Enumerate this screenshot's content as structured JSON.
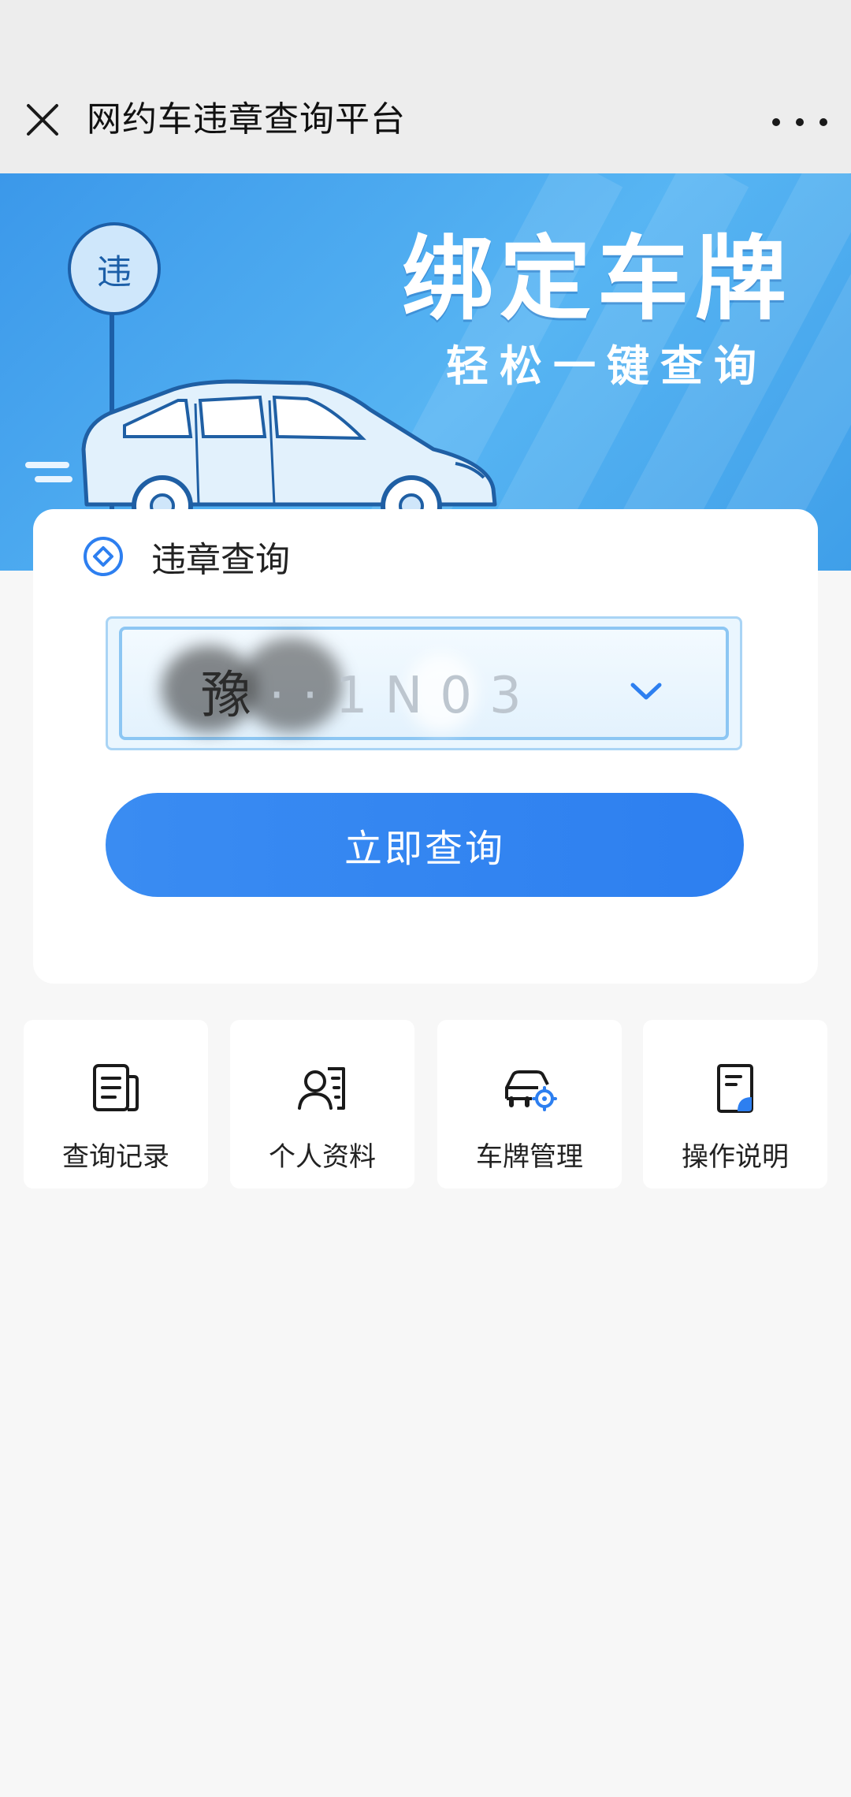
{
  "topbar": {
    "title": "网约车违章查询平台",
    "close_icon": "close-icon",
    "more_icon": "more-options-icon"
  },
  "banner": {
    "headline": "绑定车牌",
    "subline": "轻松一键查询",
    "sign_text": "违"
  },
  "query_card": {
    "heading": "违章查询",
    "plate_first": "豫",
    "plate_rest": "··1N03",
    "query_button": "立即查询"
  },
  "menu": [
    {
      "label": "查询记录",
      "icon": "query-record-icon"
    },
    {
      "label": "个人资料",
      "icon": "profile-icon"
    },
    {
      "label": "车牌管理",
      "icon": "plate-manage-icon"
    },
    {
      "label": "操作说明",
      "icon": "instructions-icon"
    }
  ],
  "colors": {
    "accent": "#2d7ff0",
    "banner": "#4aa9f0",
    "page_bg": "#f7f7f7",
    "topbar_bg": "#ededed"
  }
}
